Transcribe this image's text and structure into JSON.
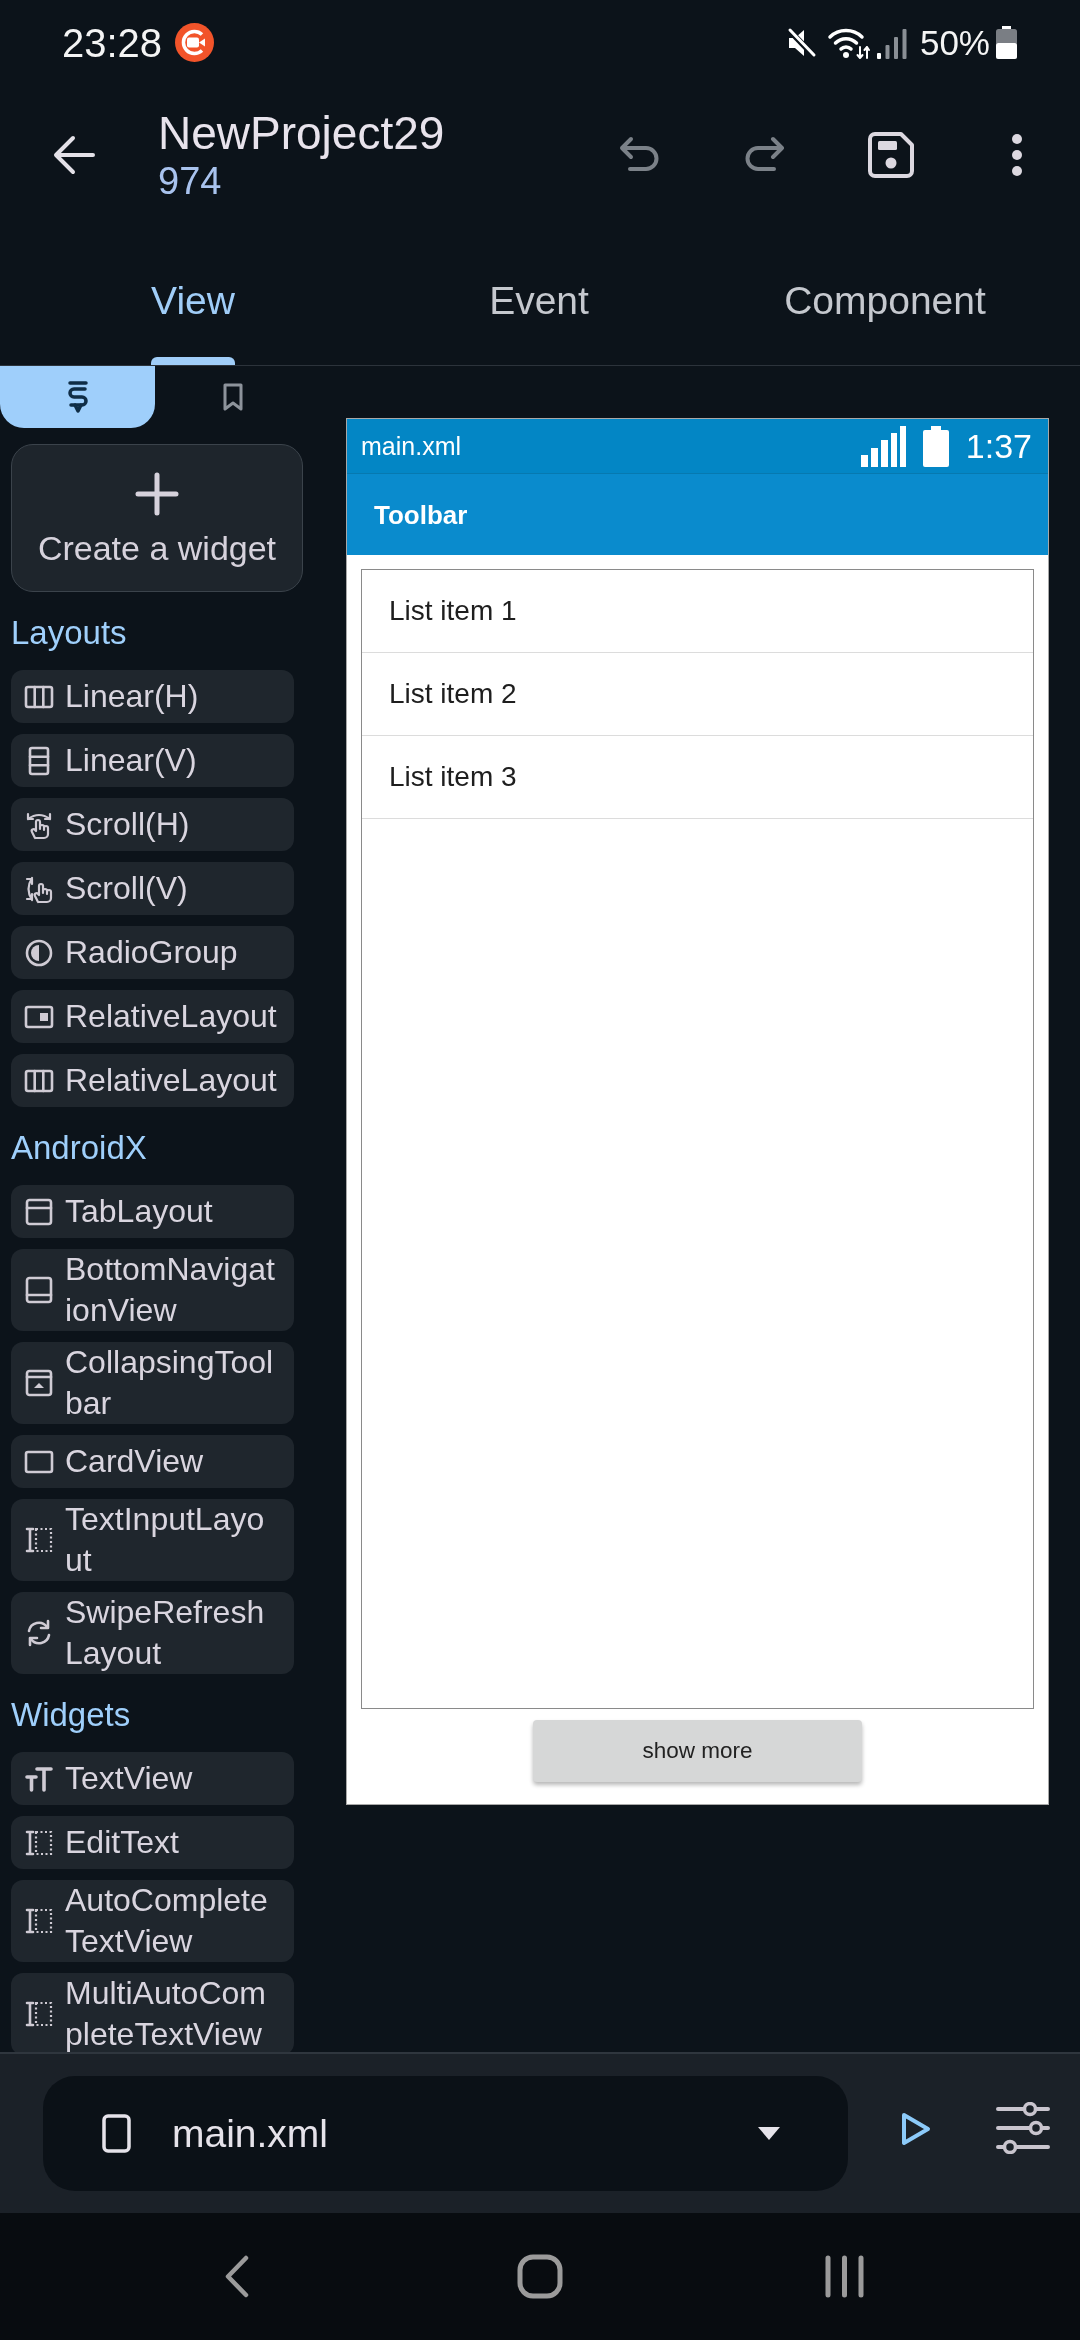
{
  "status_bar": {
    "time": "23:28",
    "battery": "50%"
  },
  "app_bar": {
    "title": "NewProject29",
    "subtitle": "974",
    "actions": [
      {
        "kind": "undo",
        "disabled": true
      },
      {
        "kind": "redo",
        "disabled": true
      },
      {
        "kind": "save",
        "disabled": false
      },
      {
        "kind": "more",
        "disabled": false
      }
    ]
  },
  "tabs": [
    {
      "label": "View",
      "selected": true
    },
    {
      "label": "Event",
      "selected": false
    },
    {
      "label": "Component",
      "selected": false
    }
  ],
  "palette_tabs": [
    {
      "kind": "widgets",
      "selected": true
    },
    {
      "kind": "bookmarks",
      "selected": false
    }
  ],
  "create_widget": {
    "label": "Create a widget"
  },
  "palette": [
    {
      "title": "Layouts",
      "items": [
        {
          "label": "Linear(H)",
          "kind": "columns"
        },
        {
          "label": "Linear(V)",
          "kind": "rows"
        },
        {
          "label": "Scroll(H)",
          "kind": "hscroll"
        },
        {
          "label": "Scroll(V)",
          "kind": "vscroll"
        },
        {
          "label": "RadioGroup",
          "kind": "radio"
        },
        {
          "label": "RelativeLayout",
          "kind": "frame"
        },
        {
          "label": "RelativeLayout",
          "kind": "columns"
        }
      ]
    },
    {
      "title": "AndroidX",
      "items": [
        {
          "label": "TabLayout",
          "kind": "tabs"
        },
        {
          "label": "BottomNavigationView",
          "kind": "bottomnav"
        },
        {
          "label": "CollapsingToolbar",
          "kind": "collapsing"
        },
        {
          "label": "CardView",
          "kind": "card"
        },
        {
          "label": "TextInputLayout",
          "kind": "input"
        },
        {
          "label": "SwipeRefreshLayout",
          "kind": "refresh"
        }
      ]
    },
    {
      "title": "Widgets",
      "items": [
        {
          "label": "TextView",
          "kind": "text"
        },
        {
          "label": "EditText",
          "kind": "input"
        },
        {
          "label": "AutoCompleteTextView",
          "kind": "input"
        },
        {
          "label": "MultiAutoCompleteTextView",
          "kind": "input"
        }
      ]
    }
  ],
  "preview": {
    "file": "main.xml",
    "time": "1:37",
    "toolbar_title": "Toolbar",
    "list_items": [
      "List item 1",
      "List item 2",
      "List item 3"
    ],
    "button": "show more"
  },
  "bottom_bar": {
    "file_selector": {
      "value": "main.xml"
    }
  }
}
